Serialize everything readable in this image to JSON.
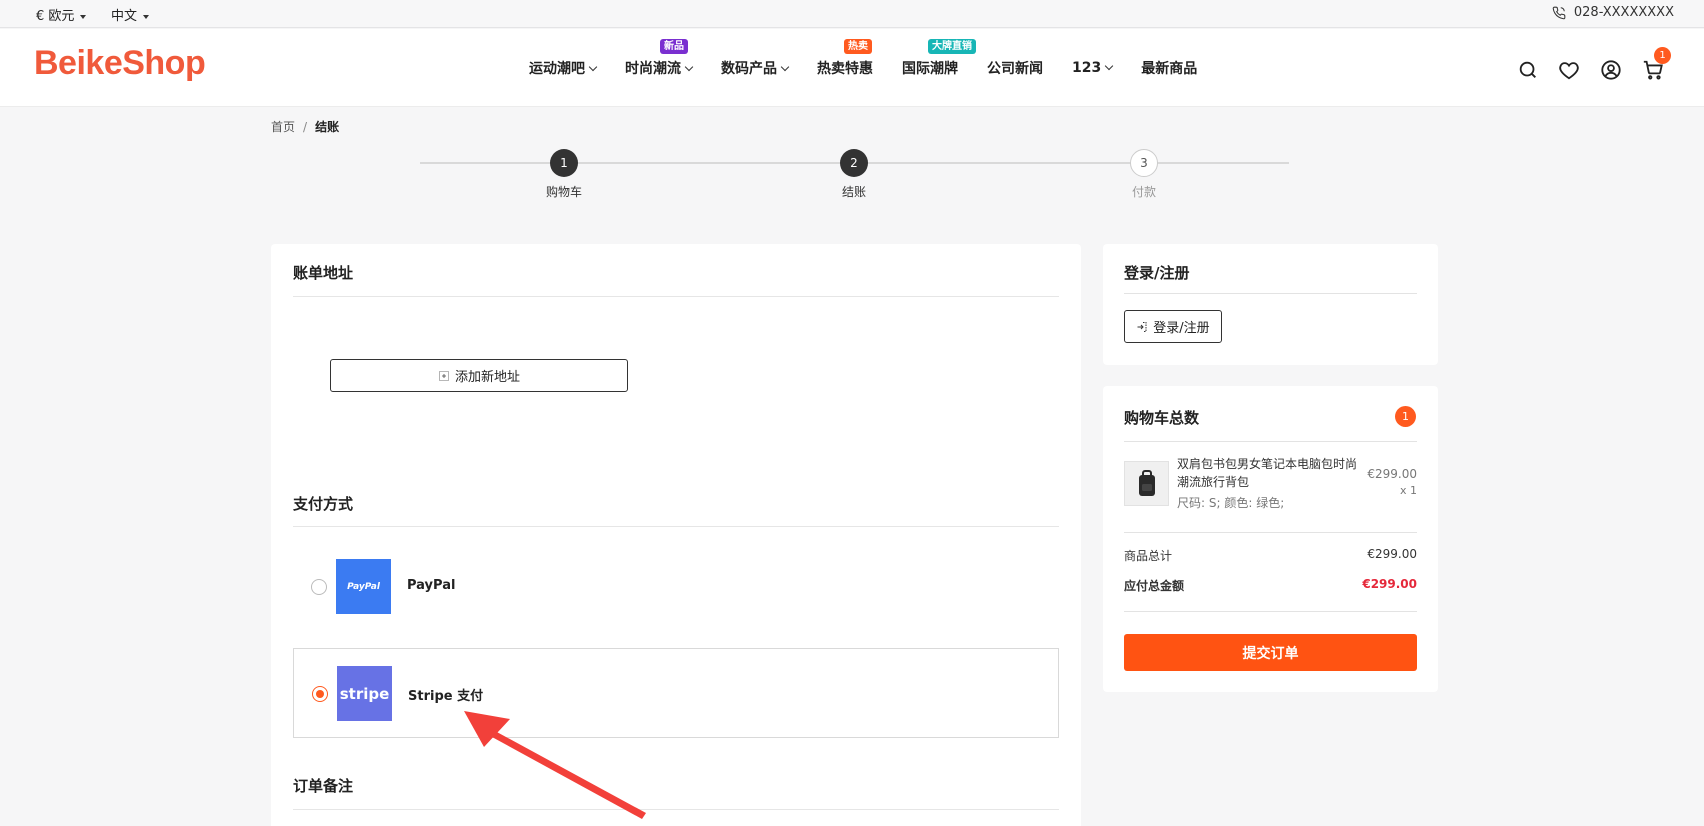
{
  "topbar": {
    "currency": "€ 欧元",
    "language": "中文",
    "phone": "028-XXXXXXXX"
  },
  "header": {
    "logo": "BeikeShop",
    "nav": [
      {
        "label": "运动潮吧",
        "dropdown": true,
        "badge": ""
      },
      {
        "label": "时尚潮流",
        "dropdown": true,
        "badge": "新品",
        "badge_color": "#7a2fd0"
      },
      {
        "label": "数码产品",
        "dropdown": true,
        "badge": ""
      },
      {
        "label": "热卖特惠",
        "dropdown": false,
        "badge": "热卖",
        "badge_color": "#ff5a1f"
      },
      {
        "label": "国际潮牌",
        "dropdown": false,
        "badge": "大牌直销",
        "badge_color": "#17b6b6"
      },
      {
        "label": "公司新闻",
        "dropdown": false,
        "badge": ""
      },
      {
        "label": "123",
        "dropdown": true,
        "badge": ""
      },
      {
        "label": "最新商品",
        "dropdown": false,
        "badge": ""
      }
    ],
    "cart_count": "1"
  },
  "breadcrumb": {
    "home": "首页",
    "separator": "/",
    "current": "结账"
  },
  "steps": [
    {
      "num": "1",
      "label": "购物车",
      "state": "done"
    },
    {
      "num": "2",
      "label": "结账",
      "state": "done"
    },
    {
      "num": "3",
      "label": "付款",
      "state": "todo"
    }
  ],
  "billing": {
    "title": "账单地址",
    "add_address": "添加新地址"
  },
  "payment": {
    "title": "支付方式",
    "methods": [
      {
        "name": "PayPal",
        "logo_text": "PayPal",
        "logo_color": "#3b7bf2",
        "selected": false
      },
      {
        "name": "Stripe 支付",
        "logo_text": "stripe",
        "logo_color": "#6772e5",
        "selected": true
      }
    ]
  },
  "order_note": {
    "title": "订单备注"
  },
  "login_card": {
    "title": "登录/注册",
    "button": "登录/注册"
  },
  "cart_card": {
    "title": "购物车总数",
    "count": "1",
    "product": {
      "name": "双肩包书包男女笔记本电脑包时尚潮流旅行背包",
      "options": "尺码: S; 颜色: 绿色;",
      "price": "€299.00",
      "qty": "x 1"
    },
    "subtotal_label": "商品总计",
    "subtotal": "€299.00",
    "total_label": "应付总金额",
    "total": "€299.00",
    "total_color": "#e5283a",
    "submit": "提交订单"
  },
  "colors": {
    "accent": "#ff5312",
    "logo": "#f05a3b"
  }
}
